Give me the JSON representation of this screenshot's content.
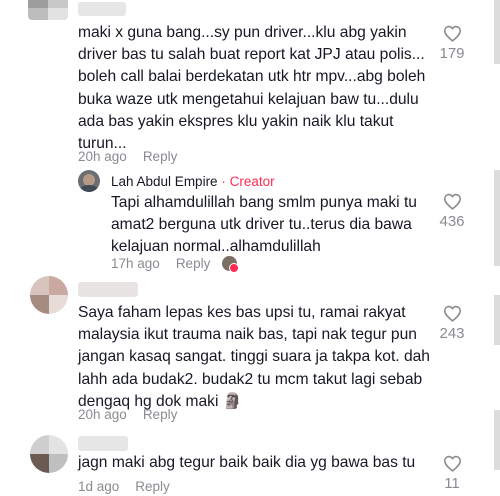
{
  "comments": [
    {
      "lines": [
        "maki x guna bang...sy pun driver...klu abg yakin",
        "driver bas tu salah buat report kat JPJ atau polis...",
        "boleh call balai berdekatan utk htr mpv...abg boleh",
        "buka waze utk mengetahui kelajuan baw tu...dulu",
        "ada bas yakin ekspres klu yakin naik klu takut",
        "turun..."
      ],
      "time": "20h ago",
      "reply": "Reply",
      "likes": "179"
    },
    {
      "author": "Lah Abdul Empire",
      "separator": "·",
      "badge": "Creator",
      "lines": [
        "Tapi alhamdulillah bang smlm punya maki tu",
        "amat2 berguna utk driver tu..terus dia bawa",
        "kelajuan normal..alhamdulillah"
      ],
      "time": "17h ago",
      "reply": "Reply",
      "likes": "436"
    },
    {
      "lines": [
        "Saya faham lepas kes bas upsi tu, ramai rakyat",
        "malaysia ikut trauma naik bas, tapi nak tegur pun",
        "jangan kasaq sangat. tinggi suara ja takpa kot. dah",
        "lahh ada budak2. budak2 tu mcm takut lagi sebab",
        "dengaq hg dok maki 🗿"
      ],
      "time": "20h ago",
      "reply": "Reply",
      "likes": "243"
    },
    {
      "lines": [
        "jagn maki abg tegur baik baik dia yg bawa bas tu"
      ],
      "time": "1d ago",
      "reply": "Reply",
      "likes": "11"
    }
  ],
  "icons": {
    "like": "heart-outline-icon",
    "creator_liked": "creator-liked-avatar-icon"
  },
  "colors": {
    "text": "#161823",
    "meta": "#8a8b91",
    "creator_badge": "#fe2c55"
  }
}
